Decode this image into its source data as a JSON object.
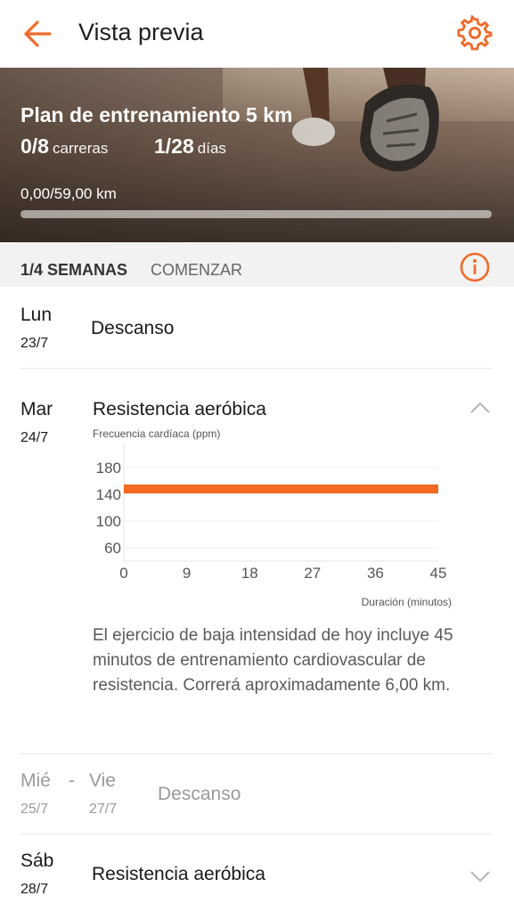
{
  "header": {
    "title": "Vista previa",
    "back_icon": "arrow-left-icon",
    "settings_icon": "gear-icon",
    "accent": "#ef6b2c"
  },
  "plan": {
    "title": "Plan de entrenamiento 5 km",
    "runs_value": "0/8",
    "runs_unit": "carreras",
    "days_value": "1/28",
    "days_unit": "días",
    "distance": "0,00/59,00 km",
    "progress": 0
  },
  "week": {
    "label": "1/4 SEMANAS",
    "start": "COMENZAR",
    "info_icon": "info-icon"
  },
  "days": [
    {
      "day": "Lun",
      "date": "23/7",
      "activity": "Descanso"
    },
    {
      "day": "Mar",
      "date": "24/7",
      "activity": "Resistencia aeróbica",
      "expanded": true,
      "description": "El ejercicio de baja intensidad de hoy incluye 45 minutos de entrenamiento cardiovascular de resistencia. Correrá aproximadamente 6,00 km."
    },
    {
      "day_from": "Mié",
      "range_sep": "-",
      "day_to": "Vie",
      "date_from": "25/7",
      "date_to": "27/7",
      "activity": "Descanso"
    },
    {
      "day": "Sáb",
      "date": "28/7",
      "activity": "Resistencia aeróbica",
      "expanded": false
    }
  ],
  "chart_data": {
    "type": "line",
    "ylabel": "Frecuencia cardíaca (ppm)",
    "xlabel": "Duración (minutos)",
    "x_ticks": [
      0,
      9,
      18,
      27,
      36,
      45
    ],
    "y_ticks": [
      60,
      100,
      140,
      180
    ],
    "xlim": [
      0,
      45
    ],
    "ylim": [
      40,
      200
    ],
    "series": [
      {
        "x": [
          0,
          45
        ],
        "y": [
          148,
          148
        ],
        "color": "#f26a21"
      }
    ],
    "grid": true
  }
}
